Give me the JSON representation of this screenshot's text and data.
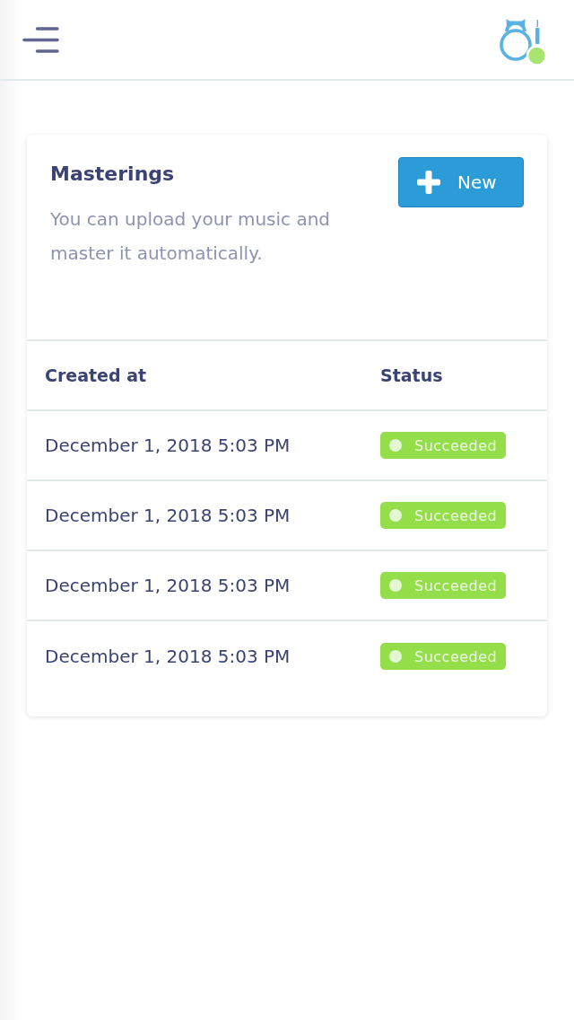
{
  "card": {
    "title": "Masterings",
    "description": "You can upload your music and master it automatically.",
    "new_button": {
      "label": "New"
    }
  },
  "table": {
    "columns": [
      "Created at",
      "Status"
    ],
    "rows": [
      {
        "created_at": "December 1, 2018 5:03 PM",
        "status": {
          "label": "Succeeded",
          "kind": "success"
        }
      },
      {
        "created_at": "December 1, 2018 5:03 PM",
        "status": {
          "label": "Succeeded",
          "kind": "success"
        }
      },
      {
        "created_at": "December 1, 2018 5:03 PM",
        "status": {
          "label": "Succeeded",
          "kind": "success"
        }
      },
      {
        "created_at": "December 1, 2018 5:03 PM",
        "status": {
          "label": "Succeeded",
          "kind": "success"
        }
      }
    ]
  }
}
